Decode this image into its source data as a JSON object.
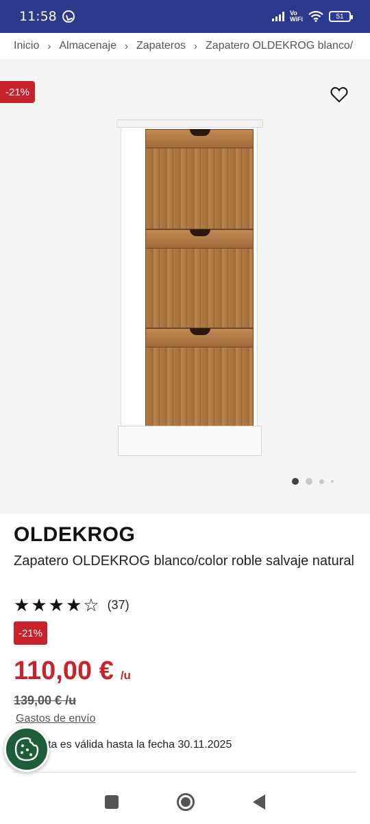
{
  "status_bar": {
    "time": "11:58",
    "vowifi_top": "Vo",
    "vowifi_bottom": "WiFi",
    "battery": "51"
  },
  "breadcrumb": {
    "items": [
      "Inicio",
      "Almacenaje",
      "Zapateros",
      "Zapatero OLDEKROG blanco/"
    ],
    "separator": "›"
  },
  "gallery": {
    "discount_badge": "-21%",
    "image_count": 4,
    "active_index": 0
  },
  "product": {
    "brand": "OLDEKROG",
    "name": "Zapatero OLDEKROG blanco/color roble salvaje natural",
    "rating_stars": 4,
    "rating_max": 5,
    "rating_count": "(37)",
    "discount_badge": "-21%",
    "price": "110,00 €",
    "price_unit": "/u",
    "old_price": "139,00 € /u",
    "shipping_link": "Gastos de envío",
    "offer_text": "ta es válida hasta la fecha 30.11.2025"
  },
  "colors": {
    "status_bar": "#2a3a8c",
    "accent_red": "#c8232c",
    "cookie_green": "#1e5c3a"
  },
  "icons": {
    "favorite": "heart-outline-icon",
    "cookie": "cookie-icon",
    "star_full": "star-filled-icon",
    "star_empty": "star-outline-icon"
  }
}
